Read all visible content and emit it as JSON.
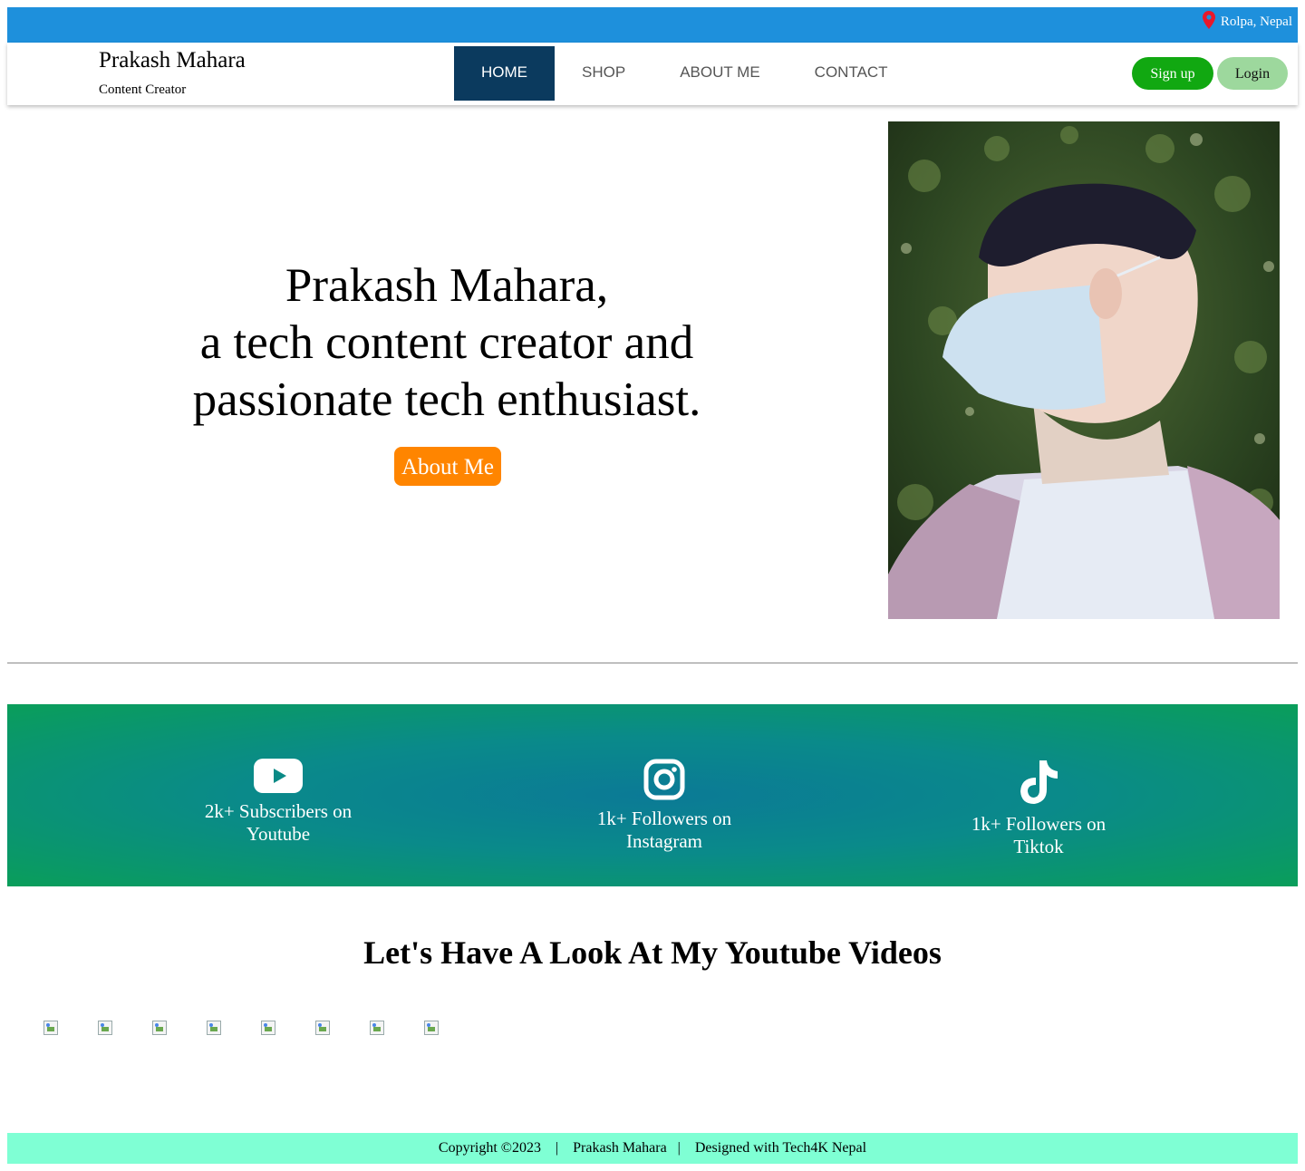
{
  "topbar": {
    "location": "Rolpa, Nepal",
    "location_icon": "map-pin-icon",
    "color": "#1e90dc"
  },
  "brand": {
    "name": "Prakash Mahara",
    "subtitle": "Content Creator"
  },
  "nav": {
    "items": [
      {
        "label": "HOME",
        "active": true
      },
      {
        "label": "SHOP",
        "active": false
      },
      {
        "label": "ABOUT ME",
        "active": false
      },
      {
        "label": "CONTACT",
        "active": false
      }
    ],
    "signup_label": "Sign up",
    "login_label": "Login"
  },
  "hero": {
    "line1": "Prakash Mahara,",
    "line2": "a tech content creator and",
    "line3": "passionate tech enthusiast.",
    "button_label": "About Me",
    "button_color": "#ff8500"
  },
  "stats": [
    {
      "icon": "youtube-icon",
      "text": "2k+ Subscribers on Youtube"
    },
    {
      "icon": "instagram-icon",
      "text": "1k+ Followers on Instagram"
    },
    {
      "icon": "tiktok-icon",
      "text": "1k+ Followers on Tiktok"
    }
  ],
  "videos": {
    "title": "Let's Have A Look At My Youtube Videos",
    "thumbnail_count": 8
  },
  "footer": {
    "copyright": "Copyright ©2023",
    "name": "Prakash Mahara",
    "designed": "Designed with Tech4K Nepal"
  }
}
